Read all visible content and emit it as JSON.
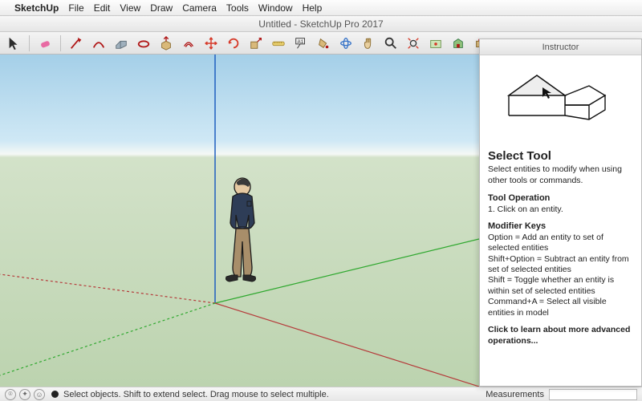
{
  "menubar": {
    "app": "SketchUp",
    "items": [
      "File",
      "Edit",
      "View",
      "Draw",
      "Camera",
      "Tools",
      "Window",
      "Help"
    ]
  },
  "title": "Untitled - SketchUp Pro 2017",
  "toolbar": {
    "tools": [
      {
        "name": "select",
        "color": "#333"
      },
      {
        "name": "eraser",
        "color": "#e86aa3"
      },
      {
        "name": "line",
        "color": "#b01717"
      },
      {
        "name": "arc",
        "color": "#b01717"
      },
      {
        "name": "rectangle",
        "color": "#6b7d8a"
      },
      {
        "name": "circle",
        "color": "#b01717"
      },
      {
        "name": "polygon",
        "color": "#b01717"
      },
      {
        "name": "pushpull",
        "color": "#c79a4e"
      },
      {
        "name": "offset",
        "color": "#b01717"
      },
      {
        "name": "move",
        "color": "#d63a2a"
      },
      {
        "name": "rotate",
        "color": "#d63a2a"
      },
      {
        "name": "scale",
        "color": "#c48a2a"
      },
      {
        "name": "tape",
        "color": "#d9b84a"
      },
      {
        "name": "text",
        "color": "#333"
      },
      {
        "name": "paint",
        "color": "#c48a2a"
      },
      {
        "name": "orbit",
        "color": "#3a76c9"
      },
      {
        "name": "pan",
        "color": "#c79a4e"
      },
      {
        "name": "zoom",
        "color": "#333"
      },
      {
        "name": "zoomext",
        "color": "#d63a2a"
      },
      {
        "name": "section",
        "color": "#b01717"
      },
      {
        "name": "warehouse",
        "color": "#3a7d4a"
      },
      {
        "name": "extension",
        "color": "#b01717"
      }
    ]
  },
  "instructor": {
    "header": "Instructor",
    "title": "Select Tool",
    "subtitle": "Select entities to modify when using other tools or commands.",
    "op_heading": "Tool Operation",
    "op_item": "1. Click on an entity.",
    "mod_heading": "Modifier Keys",
    "mod1": "Option = Add an entity to set of selected entities",
    "mod2": "Shift+Option = Subtract an entity from set of selected entities",
    "mod3": "Shift = Toggle whether an entity is within set of selected entities",
    "mod4": "Command+A = Select all visible entities in model",
    "link": "Click to learn about more advanced operations..."
  },
  "status": {
    "hint": "Select objects. Shift to extend select. Drag mouse to select multiple.",
    "meas_label": "Measurements"
  }
}
